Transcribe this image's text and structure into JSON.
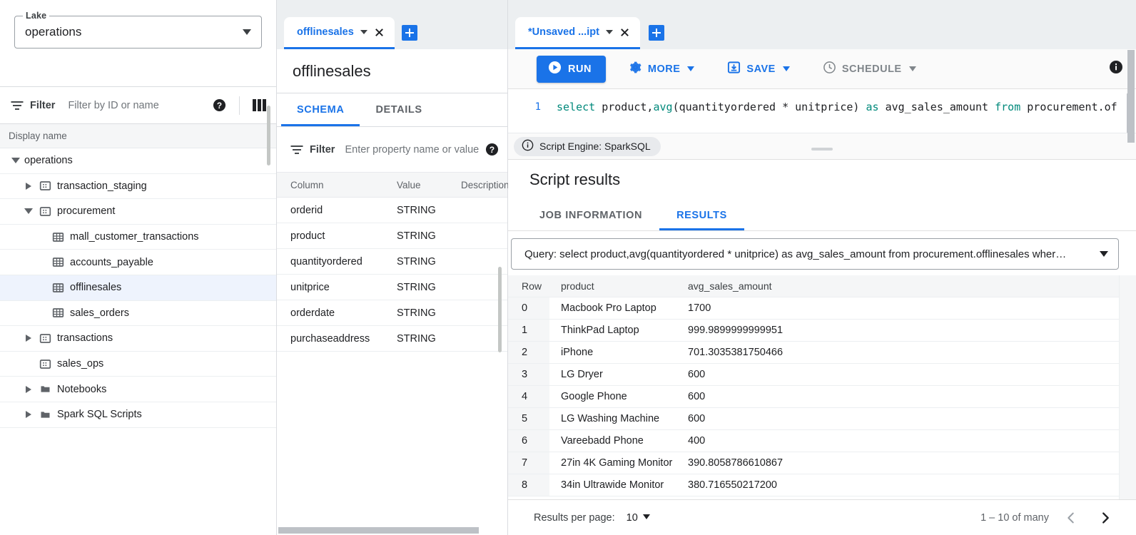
{
  "sidebar": {
    "lake": {
      "legend": "Lake",
      "value": "operations",
      "caret_icon": "chevron-down-icon"
    },
    "filter": {
      "label": "Filter",
      "placeholder": "Filter by ID or name",
      "help_icon": "help-icon",
      "columns_icon": "columns-icon",
      "filter_icon": "filter-icon"
    },
    "tree_header": "Display name",
    "tree": [
      {
        "label": "operations",
        "indent": 0,
        "twisty": "down",
        "icon": "none"
      },
      {
        "label": "transaction_staging",
        "indent": 1,
        "twisty": "right",
        "icon": "database-icon"
      },
      {
        "label": "procurement",
        "indent": 1,
        "twisty": "down",
        "icon": "database-icon"
      },
      {
        "label": "mall_customer_transactions",
        "indent": 2,
        "twisty": "none",
        "icon": "table-icon"
      },
      {
        "label": "accounts_payable",
        "indent": 2,
        "twisty": "none",
        "icon": "table-icon"
      },
      {
        "label": "offlinesales",
        "indent": 2,
        "twisty": "none",
        "icon": "table-icon",
        "selected": true
      },
      {
        "label": "sales_orders",
        "indent": 2,
        "twisty": "none",
        "icon": "table-icon"
      },
      {
        "label": "transactions",
        "indent": 1,
        "twisty": "right",
        "icon": "database-icon"
      },
      {
        "label": "sales_ops",
        "indent": 1,
        "twisty": "none",
        "icon": "database-icon"
      },
      {
        "label": "Notebooks",
        "indent": 1,
        "twisty": "right",
        "icon": "folder-icon"
      },
      {
        "label": "Spark SQL Scripts",
        "indent": 1,
        "twisty": "right",
        "icon": "folder-icon"
      }
    ]
  },
  "middle": {
    "tab": {
      "title": "offlinesales",
      "caret_icon": "chevron-down-icon",
      "close_icon": "close-icon"
    },
    "add_tab_icon": "plus-icon",
    "page_title": "offlinesales",
    "subtabs": [
      {
        "label": "SCHEMA",
        "active": true
      },
      {
        "label": "DETAILS",
        "active": false
      }
    ],
    "property_filter": {
      "label": "Filter",
      "placeholder": "Enter property name or value",
      "help_icon": "help-icon",
      "filter_icon": "filter-icon"
    },
    "schema_columns": [
      "Column",
      "Value",
      "Description"
    ],
    "schema_rows": [
      {
        "column": "orderid",
        "value": "STRING",
        "description": ""
      },
      {
        "column": "product",
        "value": "STRING",
        "description": ""
      },
      {
        "column": "quantityordered",
        "value": "STRING",
        "description": ""
      },
      {
        "column": "unitprice",
        "value": "STRING",
        "description": ""
      },
      {
        "column": "orderdate",
        "value": "STRING",
        "description": ""
      },
      {
        "column": "purchaseaddress",
        "value": "STRING",
        "description": ""
      }
    ]
  },
  "right": {
    "tab": {
      "title": "*Unsaved ...ipt",
      "caret_icon": "chevron-down-icon",
      "close_icon": "close-icon"
    },
    "add_tab_icon": "plus-icon",
    "toolbar": {
      "run_label": "RUN",
      "run_icon": "play-circle-icon",
      "more_label": "MORE",
      "more_icon": "gear-icon",
      "save_label": "SAVE",
      "save_icon": "save-icon",
      "schedule_label": "SCHEDULE",
      "schedule_icon": "clock-icon",
      "info_icon": "info-icon"
    },
    "editor": {
      "line_number": "1",
      "tokens": [
        {
          "t": "select ",
          "k": true
        },
        {
          "t": "product,",
          "k": false
        },
        {
          "t": "avg",
          "k": true
        },
        {
          "t": "(quantityordered * unitprice) ",
          "k": false
        },
        {
          "t": "as ",
          "k": true
        },
        {
          "t": "avg_sales_amount ",
          "k": false
        },
        {
          "t": "from ",
          "k": true
        },
        {
          "t": "procurement.of",
          "k": false
        }
      ]
    },
    "engine_chip": {
      "label": "Script Engine: SparkSQL",
      "icon": "info-icon"
    },
    "results": {
      "title": "Script results",
      "tabs": [
        {
          "label": "JOB INFORMATION",
          "active": false
        },
        {
          "label": "RESULTS",
          "active": true
        }
      ],
      "query_select": {
        "text": "Query: select product,avg(quantityordered * unitprice) as avg_sales_amount from procurement.offlinesales wher…",
        "caret_icon": "chevron-down-icon"
      },
      "columns": [
        "Row",
        "product",
        "avg_sales_amount"
      ],
      "rows": [
        {
          "row": "0",
          "product": "Macbook Pro Laptop",
          "avg_sales_amount": "1700"
        },
        {
          "row": "1",
          "product": "ThinkPad Laptop",
          "avg_sales_amount": "999.9899999999951"
        },
        {
          "row": "2",
          "product": "iPhone",
          "avg_sales_amount": "701.3035381750466"
        },
        {
          "row": "3",
          "product": "LG Dryer",
          "avg_sales_amount": "600"
        },
        {
          "row": "4",
          "product": "Google Phone",
          "avg_sales_amount": "600"
        },
        {
          "row": "5",
          "product": "LG Washing Machine",
          "avg_sales_amount": "600"
        },
        {
          "row": "6",
          "product": "Vareebadd Phone",
          "avg_sales_amount": "400"
        },
        {
          "row": "7",
          "product": "27in 4K Gaming Monitor",
          "avg_sales_amount": "390.8058786610867"
        },
        {
          "row": "8",
          "product": "34in Ultrawide Monitor",
          "avg_sales_amount": "380.716550217200"
        }
      ],
      "pager": {
        "per_page_label": "Results per page:",
        "per_page_value": "10",
        "range": "1 – 10 of many",
        "prev_icon": "chevron-left-icon",
        "next_icon": "chevron-right-icon"
      }
    }
  },
  "colors": {
    "accent": "#1a73e8",
    "tabstrip_bg": "#eceff1",
    "keyword": "#00897b",
    "selected_row": "#eef3fd"
  }
}
